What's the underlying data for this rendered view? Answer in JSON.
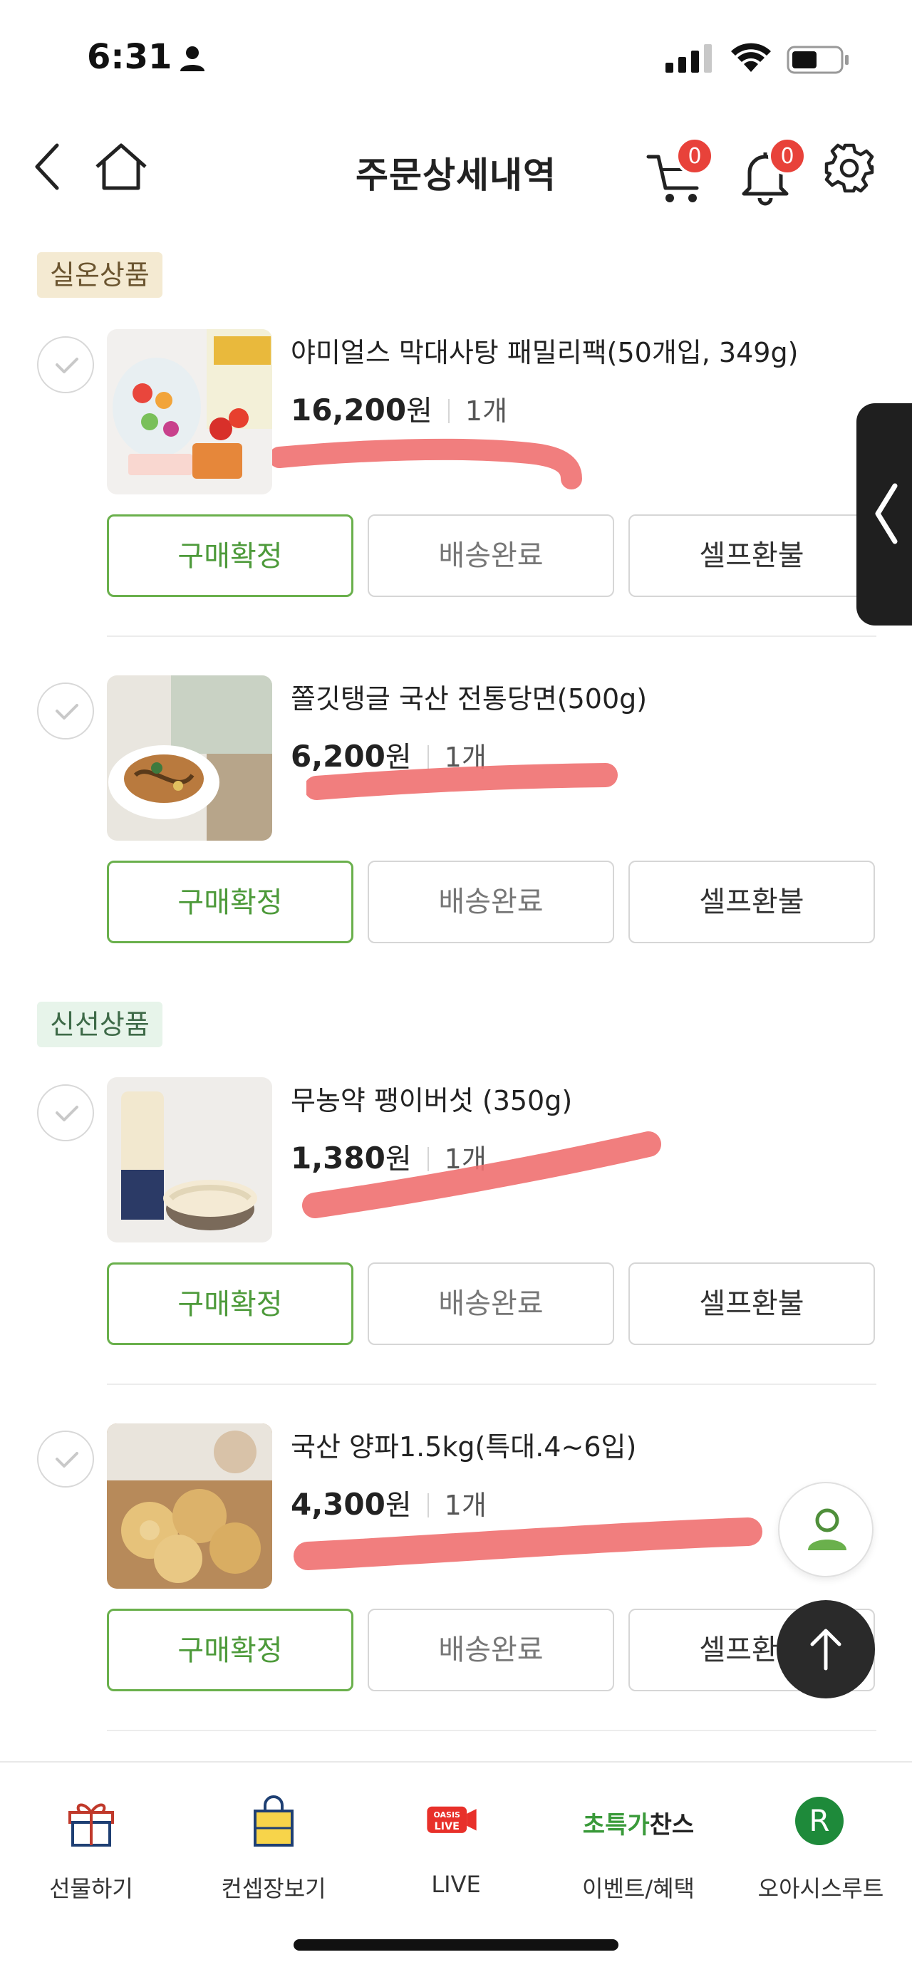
{
  "status_bar": {
    "time": "6:31"
  },
  "header": {
    "title": "주문상세내역",
    "cart_count": "0",
    "notification_count": "0"
  },
  "sections": [
    {
      "tag": "실온상품",
      "items": [
        {
          "name": "야미얼스 막대사탕 패밀리팩(50개입, 349g)",
          "price": "16,200",
          "currency": "원",
          "qty": "1개"
        },
        {
          "name": "쫄깃탱글 국산 전통당면(500g)",
          "price": "6,200",
          "currency": "원",
          "qty": "1개"
        }
      ]
    },
    {
      "tag": "신선상품",
      "items": [
        {
          "name": "무농약 팽이버섯 (350g)",
          "price": "1,380",
          "currency": "원",
          "qty": "1개"
        },
        {
          "name": "국산 양파1.5kg(특대.4~6입)",
          "price": "4,300",
          "currency": "원",
          "qty": "1개"
        }
      ]
    }
  ],
  "buttons": {
    "confirm": "구매확정",
    "status": "배송완료",
    "refund": "셀프환불"
  },
  "bottom_nav": {
    "items": [
      {
        "label": "선물하기"
      },
      {
        "label": "컨셉장보기"
      },
      {
        "label": "LIVE",
        "badge_top": "OASIS",
        "badge_bottom": "LIVE"
      },
      {
        "label": "이벤트/혜택",
        "icon_text_a": "초특가",
        "icon_text_b": "찬스"
      },
      {
        "label": "오아시스루트",
        "icon_text": "R"
      }
    ]
  },
  "colors": {
    "accent_green": "#6ab04c",
    "badge_red": "#e8423a",
    "redaction": "#f07070"
  }
}
